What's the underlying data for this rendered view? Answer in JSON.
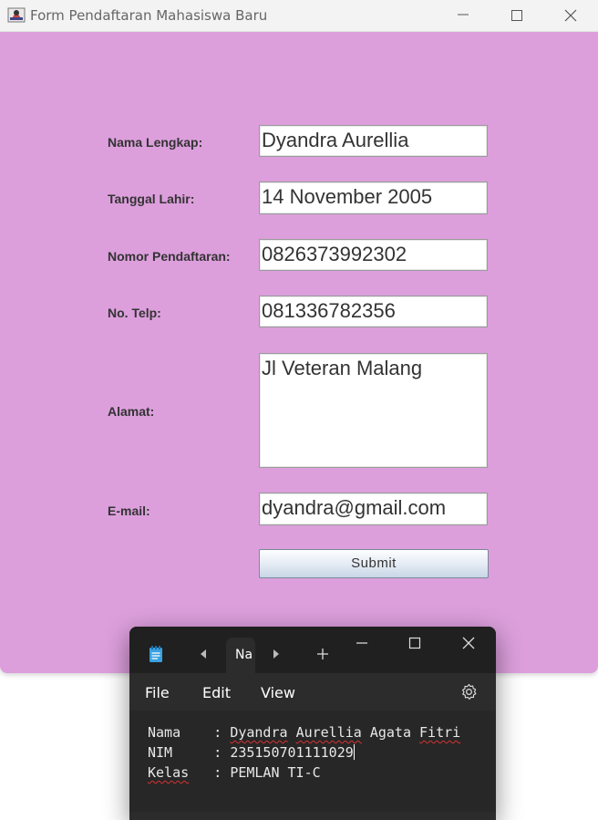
{
  "java_window": {
    "title": "Form Pendaftaran Mahasiswa Baru",
    "background_color": "#dc9fdc",
    "fields": {
      "nama": {
        "label": "Nama Lengkap:",
        "value": "Dyandra Aurellia"
      },
      "tanggal": {
        "label": "Tanggal Lahir:",
        "value": "14 November 2005"
      },
      "nomor": {
        "label": "Nomor Pendaftaran:",
        "value": "0826373992302"
      },
      "telp": {
        "label": "No. Telp:",
        "value": "081336782356"
      },
      "alamat": {
        "label": "Alamat:",
        "value": "Jl Veteran Malang"
      },
      "email": {
        "label": "E-mail:",
        "value": "dyandra@gmail.com"
      }
    },
    "submit_label": "Submit"
  },
  "notepad": {
    "tab_label": "Na",
    "menu": {
      "file": "File",
      "edit": "Edit",
      "view": "View"
    },
    "lines": [
      {
        "key": "Nama",
        "sep": "    : ",
        "value_spell": "Dyandra",
        "value_rest1": " ",
        "value_spell2": "Aurellia",
        "value_rest2": " Agata ",
        "value_spell3": "Fitri"
      },
      {
        "key": "NIM",
        "sep": "     : ",
        "value": "235150701111029"
      },
      {
        "key": "Kelas",
        "sep": "   : ",
        "value": "PEMLAN TI-C"
      }
    ]
  }
}
